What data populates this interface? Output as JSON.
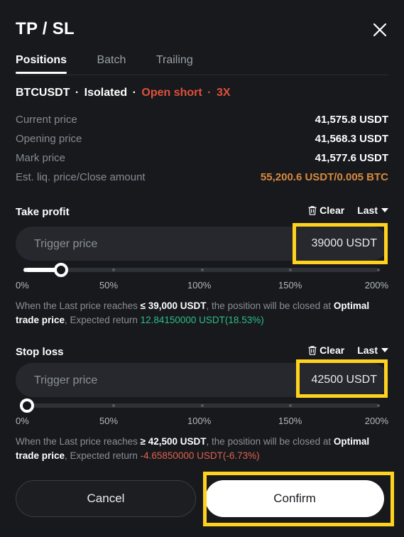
{
  "header": {
    "title": "TP / SL",
    "close_icon": "close-icon"
  },
  "tabs": [
    {
      "label": "Positions",
      "active": true
    },
    {
      "label": "Batch",
      "active": false
    },
    {
      "label": "Trailing",
      "active": false
    }
  ],
  "position": {
    "symbol": "BTCUSDT",
    "margin_mode": "Isolated",
    "side": "Open short",
    "leverage": "3X",
    "separator": "·",
    "rows": [
      {
        "label": "Current price",
        "value": "41,575.8 USDT",
        "accent": "none"
      },
      {
        "label": "Opening price",
        "value": "41,568.3 USDT",
        "accent": "none"
      },
      {
        "label": "Mark price",
        "value": "41,577.6 USDT",
        "accent": "none"
      },
      {
        "label": "Est. liq. price/Close amount",
        "value": "55,200.6 USDT/0.005 BTC",
        "accent": "orange"
      }
    ]
  },
  "take_profit": {
    "title": "Take profit",
    "clear_label": "Clear",
    "clear_icon": "trash-icon",
    "price_type": "Last",
    "caret_icon": "chevron-down-icon",
    "placeholder": "Trigger price",
    "value": "",
    "unit_value": "39000 USDT",
    "slider": {
      "percent": 20,
      "labels": [
        "0%",
        "50%",
        "100%",
        "150%",
        "200%"
      ],
      "min": 0,
      "max": 200
    },
    "note": {
      "prefix": "When the Last price reaches ",
      "trigger": "≤ 39,000 USDT",
      "middle": ", the position will be closed at ",
      "order_type": "Optimal trade price",
      "return_prefix": ", Expected return ",
      "return_value": "12.84150000 USDT(18.53%)",
      "return_sign": "positive"
    }
  },
  "stop_loss": {
    "title": "Stop loss",
    "clear_label": "Clear",
    "clear_icon": "trash-icon",
    "price_type": "Last",
    "caret_icon": "chevron-down-icon",
    "placeholder": "Trigger price",
    "value": "",
    "unit_value": "42500 USDT",
    "slider": {
      "percent": 1,
      "labels": [
        "0%",
        "50%",
        "100%",
        "150%",
        "200%"
      ],
      "min": 0,
      "max": 200
    },
    "note": {
      "prefix": "When the Last price reaches ",
      "trigger": "≥ 42,500 USDT",
      "middle": ", the position will be closed at ",
      "order_type": "Optimal trade price",
      "return_prefix": ", Expected return ",
      "return_value": "-4.65850000 USDT(-6.73%)",
      "return_sign": "negative"
    }
  },
  "footer": {
    "cancel_label": "Cancel",
    "confirm_label": "Confirm"
  },
  "colors": {
    "background": "#17191d",
    "highlight": "#ffd21e",
    "short_red": "#e0503c",
    "liq_orange": "#d98a3e",
    "profit_green": "#2ebd85",
    "loss_red": "#e0604f",
    "input_bg": "#26282d"
  }
}
